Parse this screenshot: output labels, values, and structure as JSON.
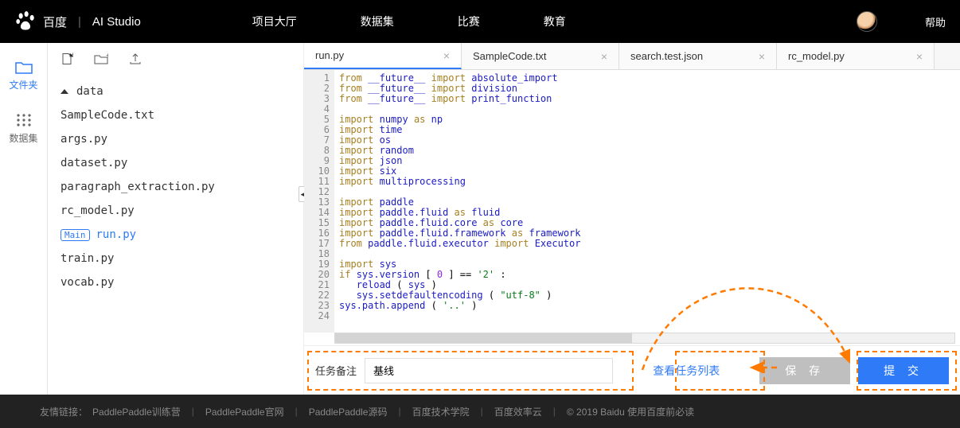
{
  "header": {
    "brand_left": "百度",
    "brand_right": "AI Studio",
    "nav": [
      "项目大厅",
      "数据集",
      "比赛",
      "教育"
    ],
    "help": "帮助"
  },
  "rail": [
    {
      "label": "文件夹",
      "icon": "folder-icon",
      "active": true
    },
    {
      "label": "数据集",
      "icon": "dataset-icon",
      "active": false
    }
  ],
  "tree": {
    "folder": "data",
    "files": [
      "SampleCode.txt",
      "args.py",
      "dataset.py",
      "paragraph_extraction.py",
      "rc_model.py",
      "run.py",
      "train.py",
      "vocab.py"
    ],
    "main_badge": "Main",
    "selected": "run.py"
  },
  "tabs": [
    {
      "label": "run.py",
      "active": true
    },
    {
      "label": "SampleCode.txt",
      "active": false
    },
    {
      "label": "search.test.json",
      "active": false
    },
    {
      "label": "rc_model.py",
      "active": false
    }
  ],
  "code": [
    {
      "n": 1,
      "t": [
        [
          "kw",
          "from"
        ],
        [
          "",
          ""
        ],
        [
          "id",
          "__future__"
        ],
        [
          "",
          ""
        ],
        [
          "kw",
          "import"
        ],
        [
          "",
          ""
        ],
        [
          "id",
          "absolute_import"
        ]
      ]
    },
    {
      "n": 2,
      "t": [
        [
          "kw",
          "from"
        ],
        [
          "",
          ""
        ],
        [
          "id",
          "__future__"
        ],
        [
          "",
          ""
        ],
        [
          "kw",
          "import"
        ],
        [
          "",
          ""
        ],
        [
          "id",
          "division"
        ]
      ]
    },
    {
      "n": 3,
      "t": [
        [
          "kw",
          "from"
        ],
        [
          "",
          ""
        ],
        [
          "id",
          "__future__"
        ],
        [
          "",
          ""
        ],
        [
          "kw",
          "import"
        ],
        [
          "",
          ""
        ],
        [
          "id",
          "print_function"
        ]
      ]
    },
    {
      "n": 4,
      "t": []
    },
    {
      "n": 5,
      "t": [
        [
          "kw",
          "import"
        ],
        [
          "",
          ""
        ],
        [
          "id",
          "numpy"
        ],
        [
          "",
          ""
        ],
        [
          "kw",
          "as"
        ],
        [
          "",
          ""
        ],
        [
          "id",
          "np"
        ]
      ]
    },
    {
      "n": 6,
      "t": [
        [
          "kw",
          "import"
        ],
        [
          "",
          ""
        ],
        [
          "id",
          "time"
        ]
      ]
    },
    {
      "n": 7,
      "t": [
        [
          "kw",
          "import"
        ],
        [
          "",
          ""
        ],
        [
          "id",
          "os"
        ]
      ]
    },
    {
      "n": 8,
      "t": [
        [
          "kw",
          "import"
        ],
        [
          "",
          ""
        ],
        [
          "id",
          "random"
        ]
      ]
    },
    {
      "n": 9,
      "t": [
        [
          "kw",
          "import"
        ],
        [
          "",
          ""
        ],
        [
          "id",
          "json"
        ]
      ]
    },
    {
      "n": 10,
      "t": [
        [
          "kw",
          "import"
        ],
        [
          "",
          ""
        ],
        [
          "id",
          "six"
        ]
      ]
    },
    {
      "n": 11,
      "t": [
        [
          "kw",
          "import"
        ],
        [
          "",
          ""
        ],
        [
          "id",
          "multiprocessing"
        ]
      ]
    },
    {
      "n": 12,
      "t": []
    },
    {
      "n": 13,
      "t": [
        [
          "kw",
          "import"
        ],
        [
          "",
          ""
        ],
        [
          "id",
          "paddle"
        ]
      ]
    },
    {
      "n": 14,
      "t": [
        [
          "kw",
          "import"
        ],
        [
          "",
          ""
        ],
        [
          "id",
          "paddle.fluid"
        ],
        [
          "",
          ""
        ],
        [
          "kw",
          "as"
        ],
        [
          "",
          ""
        ],
        [
          "id",
          "fluid"
        ]
      ]
    },
    {
      "n": 15,
      "t": [
        [
          "kw",
          "import"
        ],
        [
          "",
          ""
        ],
        [
          "id",
          "paddle.fluid.core"
        ],
        [
          "",
          ""
        ],
        [
          "kw",
          "as"
        ],
        [
          "",
          ""
        ],
        [
          "id",
          "core"
        ]
      ]
    },
    {
      "n": 16,
      "t": [
        [
          "kw",
          "import"
        ],
        [
          "",
          ""
        ],
        [
          "id",
          "paddle.fluid.framework"
        ],
        [
          "",
          ""
        ],
        [
          "kw",
          "as"
        ],
        [
          "",
          ""
        ],
        [
          "id",
          "framework"
        ]
      ]
    },
    {
      "n": 17,
      "t": [
        [
          "kw",
          "from"
        ],
        [
          "",
          ""
        ],
        [
          "id",
          "paddle.fluid.executor"
        ],
        [
          "",
          ""
        ],
        [
          "kw",
          "import"
        ],
        [
          "",
          ""
        ],
        [
          "id",
          "Executor"
        ]
      ]
    },
    {
      "n": 18,
      "t": []
    },
    {
      "n": 19,
      "t": [
        [
          "kw",
          "import"
        ],
        [
          "",
          ""
        ],
        [
          "id",
          "sys"
        ]
      ]
    },
    {
      "n": 20,
      "t": [
        [
          "kw",
          "if"
        ],
        [
          "",
          ""
        ],
        [
          "id",
          "sys.version"
        ],
        [
          "",
          "["
        ],
        [
          "num",
          "0"
        ],
        [
          "",
          "] == "
        ],
        [
          "str",
          "'2'"
        ],
        [
          "",
          ":"
        ]
      ]
    },
    {
      "n": 21,
      "t": [
        [
          "",
          "    "
        ],
        [
          "id",
          "reload"
        ],
        [
          "",
          "("
        ],
        [
          "id",
          "sys"
        ],
        [
          "",
          ")"
        ]
      ]
    },
    {
      "n": 22,
      "t": [
        [
          "",
          "    "
        ],
        [
          "id",
          "sys.setdefaultencoding"
        ],
        [
          "",
          "("
        ],
        [
          "str",
          "\"utf-8\""
        ],
        [
          "",
          ")"
        ]
      ]
    },
    {
      "n": 23,
      "t": [
        [
          "id",
          "sys.path.append"
        ],
        [
          "",
          "("
        ],
        [
          "str",
          "'..'"
        ],
        [
          "",
          ")"
        ]
      ]
    },
    {
      "n": 24,
      "t": []
    }
  ],
  "bottom": {
    "label": "任务备注",
    "value": "基线",
    "view_tasks": "查看任务列表",
    "save": "保 存",
    "submit": "提 交"
  },
  "footer": {
    "lead": "友情链接：",
    "links": [
      "PaddlePaddle训练营",
      "PaddlePaddle官网",
      "PaddlePaddle源码",
      "百度技术学院",
      "百度效率云"
    ],
    "copyright": "© 2019 Baidu 使用百度前必读"
  }
}
